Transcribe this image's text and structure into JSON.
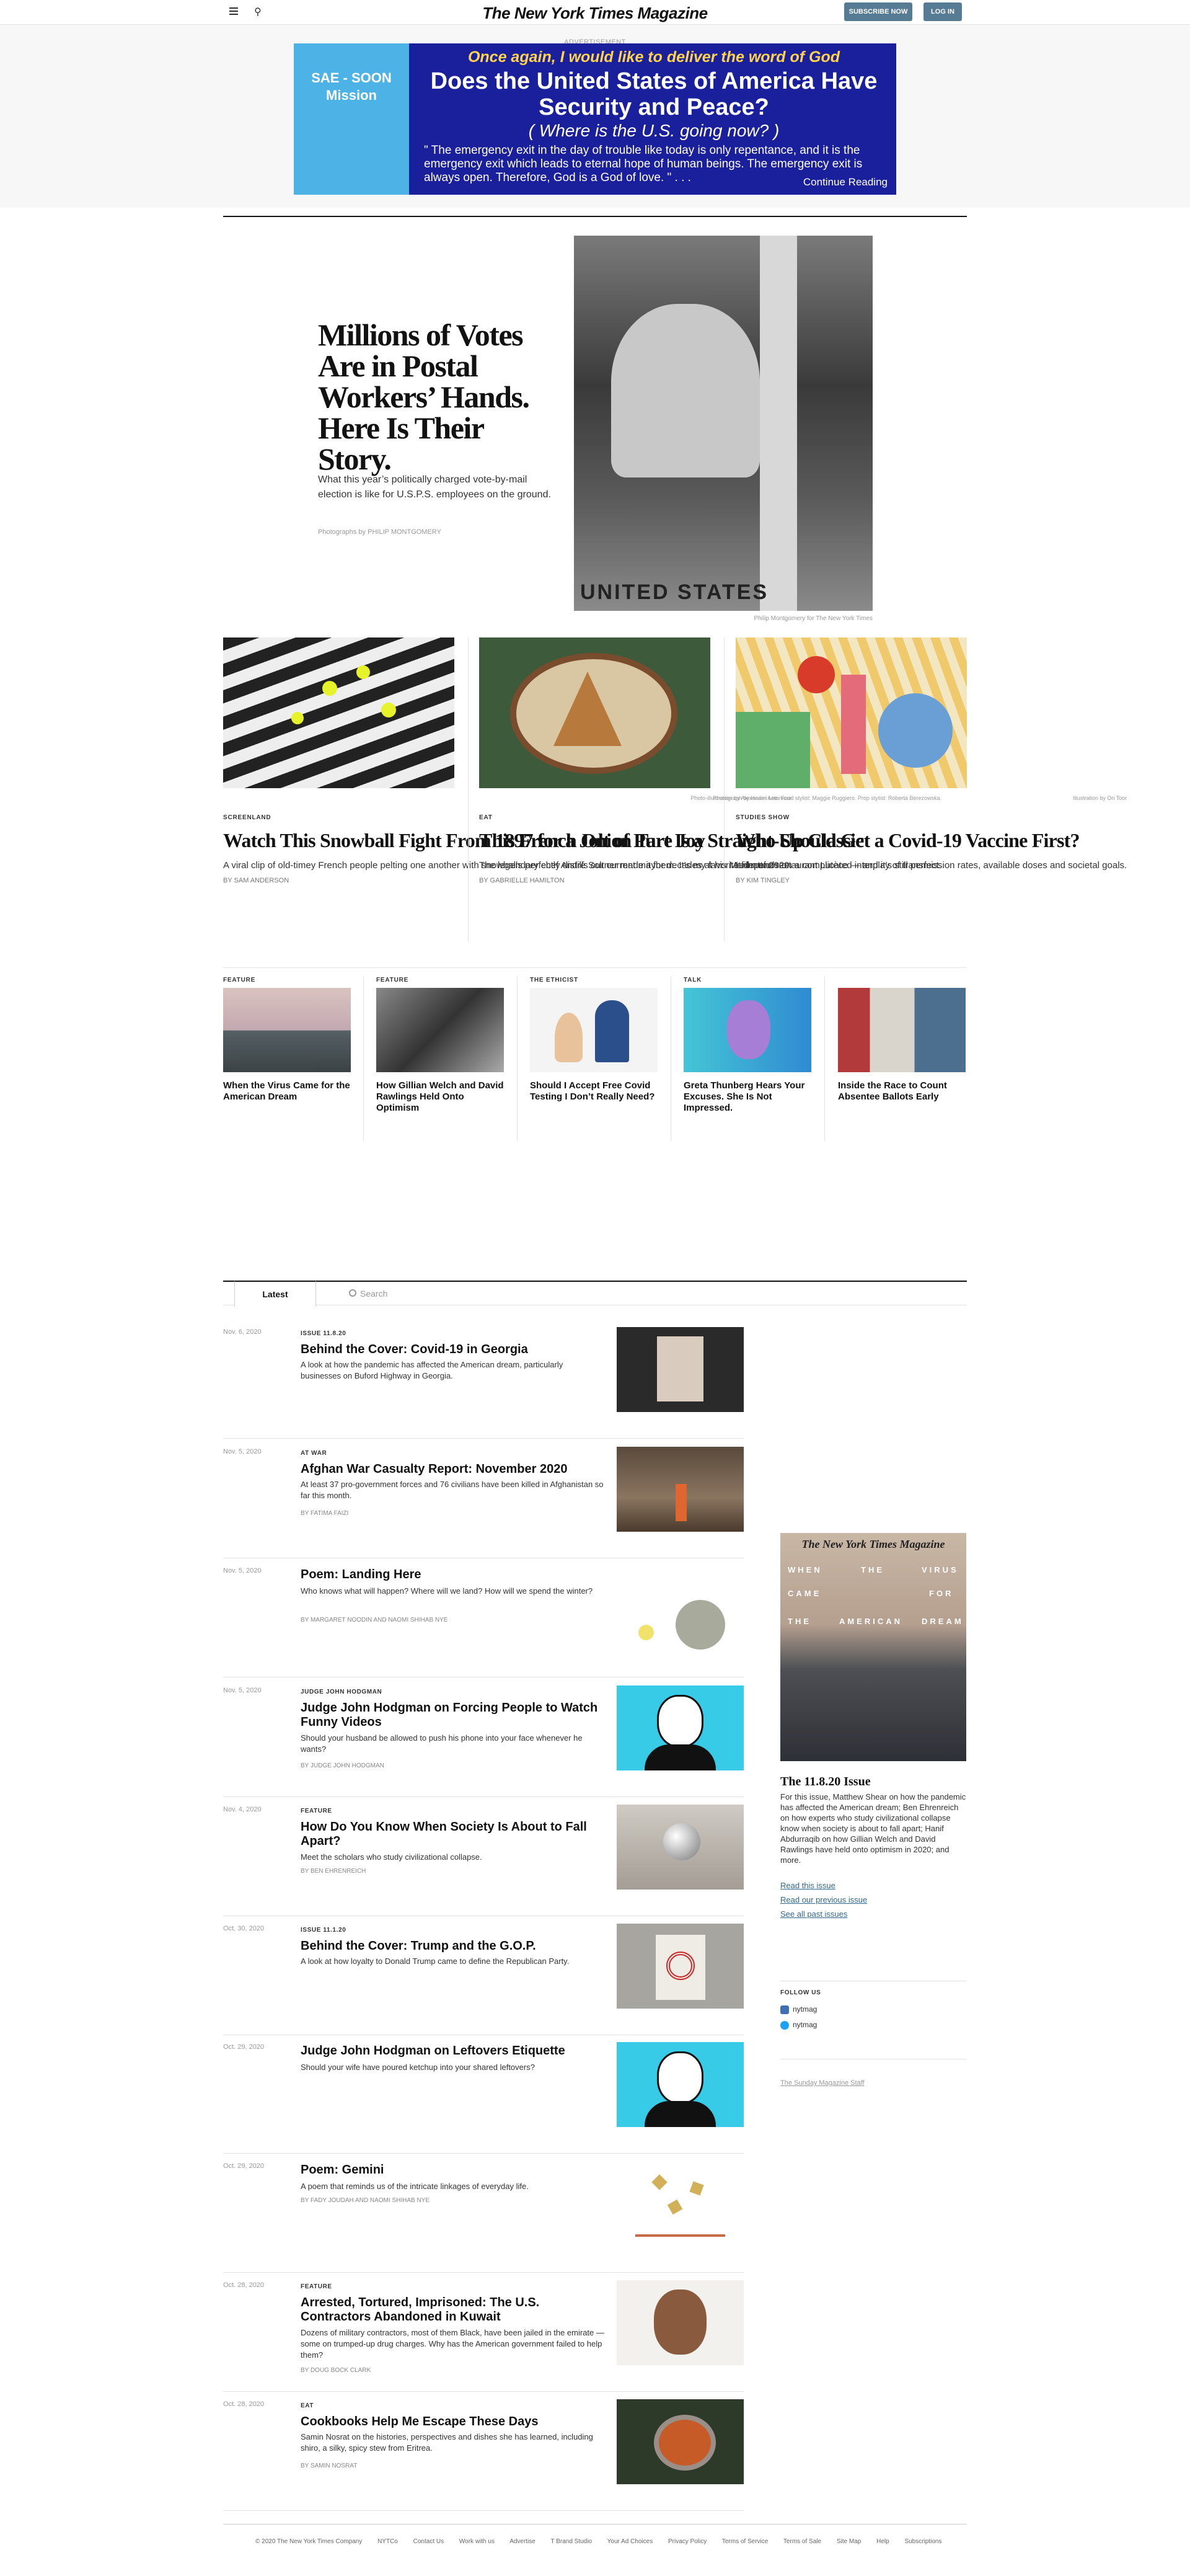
{
  "header": {
    "logo": "The New York Times Magazine",
    "subscribe": "Subscribe Now",
    "login": "Log In",
    "menu_icon": "hamburger-icon",
    "search_icon": "search-icon"
  },
  "ad": {
    "label": "ADVERTISEMENT",
    "side": "SAE - SOON Mission",
    "top": "Once again, I would like to deliver the word of God",
    "headline": "Does the United States of America Have Security and Peace?",
    "sub": "( Where is the U.S. going now? )",
    "body": "\" The emergency exit in the day of trouble like today is only repentance, and it is the emergency exit which leads to eternal hope of human beings. The emergency exit is always open. Therefore, God is a God of love. \" . . .",
    "cta": "Continue Reading"
  },
  "hero": {
    "title": "Millions of Votes Are in Postal Workers’ Hands. Here Is Their Story.",
    "summary": "What this year’s politically charged vote-by-mail election is like for U.S.P.S. employees on the ground.",
    "credit": "Photographs by PHILIP MONTGOMERY",
    "image_text": "UNITED STATES",
    "caption": "Philip Montgomery for The New York Times"
  },
  "cards": [
    {
      "caption": "Photo-illustration by Alexander Antonisse",
      "kicker": "SCREENLAND",
      "title": "Watch This Snowball Fight From 1897 for a Jolt of Pure Joy",
      "summary": "A viral clip of old-timey French people pelting one another with snowballs perfectly distills our current mayhem. It’s my favorite film of 2020.",
      "byline": "By SAM ANDERSON"
    },
    {
      "caption": "Photograph by Heami Lee. Food stylist: Maggie Ruggiero. Prop stylist: Roberta Berezowska.",
      "kicker": "EAT",
      "title": "This French Onion Tart Is a Straight-Up Classic",
      "summary": "The legendary chef André Soltner made it for decades at his Manhattan restaurant Lutèce — and it’s still perfect.",
      "byline": "By GABRIELLE HAMILTON"
    },
    {
      "caption": "Illustration by Ori Toor",
      "kicker": "STUDIES SHOW",
      "title": "Who Should Get a Covid-19 Vaccine First?",
      "summary": "It depends on a complicated interplay of transmission rates, available doses and societal goals.",
      "byline": "By KIM TINGLEY"
    }
  ],
  "strip": [
    {
      "kicker": "FEATURE",
      "title": "When the Virus Came for the American Dream"
    },
    {
      "kicker": "FEATURE",
      "title": "How Gillian Welch and David Rawlings Held Onto Optimism"
    },
    {
      "kicker": "THE ETHICIST",
      "title": "Should I Accept Free Covid Testing I Don’t Really Need?"
    },
    {
      "kicker": "TALK",
      "title": "Greta Thunberg Hears Your Excuses. She Is Not Impressed."
    },
    {
      "kicker": "",
      "title": "Inside the Race to Count Absentee Ballots Early"
    }
  ],
  "tabs": {
    "latest": "Latest",
    "search_placeholder": "Search"
  },
  "latest": [
    {
      "date": "Nov. 6, 2020",
      "kicker": "ISSUE 11.8.20",
      "title": "Behind the Cover: Covid-19 in Georgia",
      "summary": "A look at how the pandemic has affected the American dream, particularly businesses on Buford Highway in Georgia.",
      "byline": ""
    },
    {
      "date": "Nov. 5, 2020",
      "kicker": "AT WAR",
      "title": "Afghan War Casualty Report: November 2020",
      "summary": "At least 37 pro-government forces and 76 civilians have been killed in Afghanistan so far this month.",
      "byline": "By FATIMA FAIZI"
    },
    {
      "date": "Nov. 5, 2020",
      "kicker": "",
      "title": "Poem: Landing Here",
      "summary": "Who knows what will happen? Where will we land? How will we spend the winter?",
      "byline": "By MARGARET NOODIN and NAOMI SHIHAB NYE"
    },
    {
      "date": "Nov. 5, 2020",
      "kicker": "JUDGE JOHN HODGMAN",
      "title": "Judge John Hodgman on Forcing People to Watch Funny Videos",
      "summary": "Should your husband be allowed to push his phone into your face whenever he wants?",
      "byline": "By JUDGE JOHN HODGMAN"
    },
    {
      "date": "Nov. 4, 2020",
      "kicker": "FEATURE",
      "title": "How Do You Know When Society Is About to Fall Apart?",
      "summary": "Meet the scholars who study civilizational collapse.",
      "byline": "By BEN EHRENREICH"
    },
    {
      "date": "Oct. 30, 2020",
      "kicker": "ISSUE 11.1.20",
      "title": "Behind the Cover: Trump and the G.O.P.",
      "summary": "A look at how loyalty to Donald Trump came to define the Republican Party.",
      "byline": ""
    },
    {
      "date": "Oct. 29, 2020",
      "kicker": "",
      "title": "Judge John Hodgman on Leftovers Etiquette",
      "summary": "Should your wife have poured ketchup into your shared leftovers?",
      "byline": ""
    },
    {
      "date": "Oct. 29, 2020",
      "kicker": "",
      "title": "Poem: Gemini",
      "summary": "A poem that reminds us of the intricate linkages of everyday life.",
      "byline": "By FADY JOUDAH and NAOMI SHIHAB NYE"
    },
    {
      "date": "Oct. 28, 2020",
      "kicker": "FEATURE",
      "title": "Arrested, Tortured, Imprisoned: The U.S. Contractors Abandoned in Kuwait",
      "summary": "Dozens of military contractors, most of them Black, have been jailed in the emirate — some on trumped-up drug charges. Why has the American government failed to help them?",
      "byline": "By DOUG BOCK CLARK"
    },
    {
      "date": "Oct. 28, 2020",
      "kicker": "EAT",
      "title": "Cookbooks Help Me Escape These Days",
      "summary": "Samin Nosrat on the histories, perspectives and dishes she has learned, including shiro, a silky, spicy stew from Eritrea.",
      "byline": "By SAMIN NOSRAT"
    }
  ],
  "sidebar": {
    "mag_title": "The New York Times Magazine",
    "cover_words": [
      "WHEN",
      "THE",
      "VIRUS",
      "CAME",
      "FOR",
      "THE",
      "AMERICAN",
      "DREAM"
    ],
    "issue": "The 11.8.20 Issue",
    "desc": "For this issue, Matthew Shear on how the pandemic has affected the American dream; Ben Ehrenreich on how experts who study civilizational collapse know when society is about to fall apart; Hanif Abdurraqib on how Gillian Welch and David Rawlings have held onto optimism in 2020; and more.",
    "links": [
      "Read this issue",
      "Read our previous issue",
      "See all past issues"
    ],
    "follow": "FOLLOW US",
    "social": [
      "nytmag",
      "nytmag"
    ],
    "staff": "The Sunday Magazine Staff"
  },
  "footer": [
    "© 2020 The New York Times Company",
    "NYTCo",
    "Contact Us",
    "Work with us",
    "Advertise",
    "T Brand Studio",
    "Your Ad Choices",
    "Privacy Policy",
    "Terms of Service",
    "Terms of Sale",
    "Site Map",
    "Help",
    "Subscriptions"
  ]
}
